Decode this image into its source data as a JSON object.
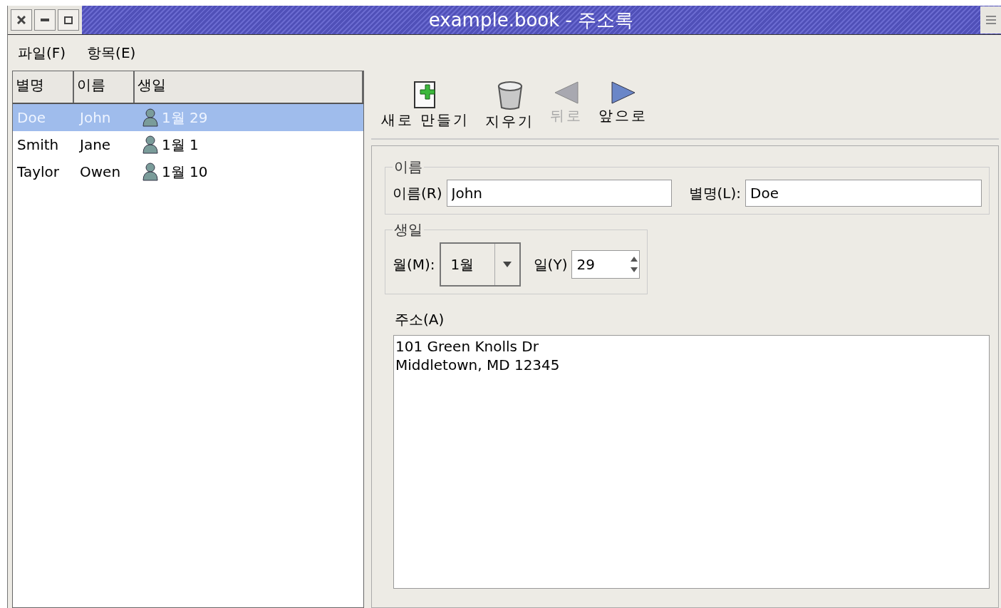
{
  "window": {
    "title": "example.book - 주소록"
  },
  "menu": [
    {
      "label": "파일(F)"
    },
    {
      "label": "항목(E)"
    }
  ],
  "list": {
    "columns": [
      "별명",
      "이름",
      "생일"
    ],
    "rows": [
      {
        "nickname": "Doe",
        "name": "John",
        "birthday": "1월 29",
        "selected": true
      },
      {
        "nickname": "Smith",
        "name": "Jane",
        "birthday": "1월 1",
        "selected": false
      },
      {
        "nickname": "Taylor",
        "name": "Owen",
        "birthday": "1월 10",
        "selected": false
      }
    ]
  },
  "toolbar": [
    {
      "kind": "new",
      "label": "새로 만들기",
      "disabled": false
    },
    {
      "kind": "delete",
      "label": "지우기",
      "disabled": false
    },
    {
      "kind": "back",
      "label": "뒤로",
      "disabled": true
    },
    {
      "kind": "forward",
      "label": "앞으로",
      "disabled": false
    }
  ],
  "name_group": {
    "title": "이름",
    "first_label": "이름(R)",
    "first_value": "John",
    "nick_label": "별명(L):",
    "nick_value": "Doe"
  },
  "birthday_group": {
    "title": "생일",
    "month_label": "월(M):",
    "month_value": "1월",
    "day_label": "일(Y)",
    "day_value": "29"
  },
  "address": {
    "label": "주소(A)",
    "value": "101 Green Knolls Dr\nMiddletown, MD 12345"
  }
}
